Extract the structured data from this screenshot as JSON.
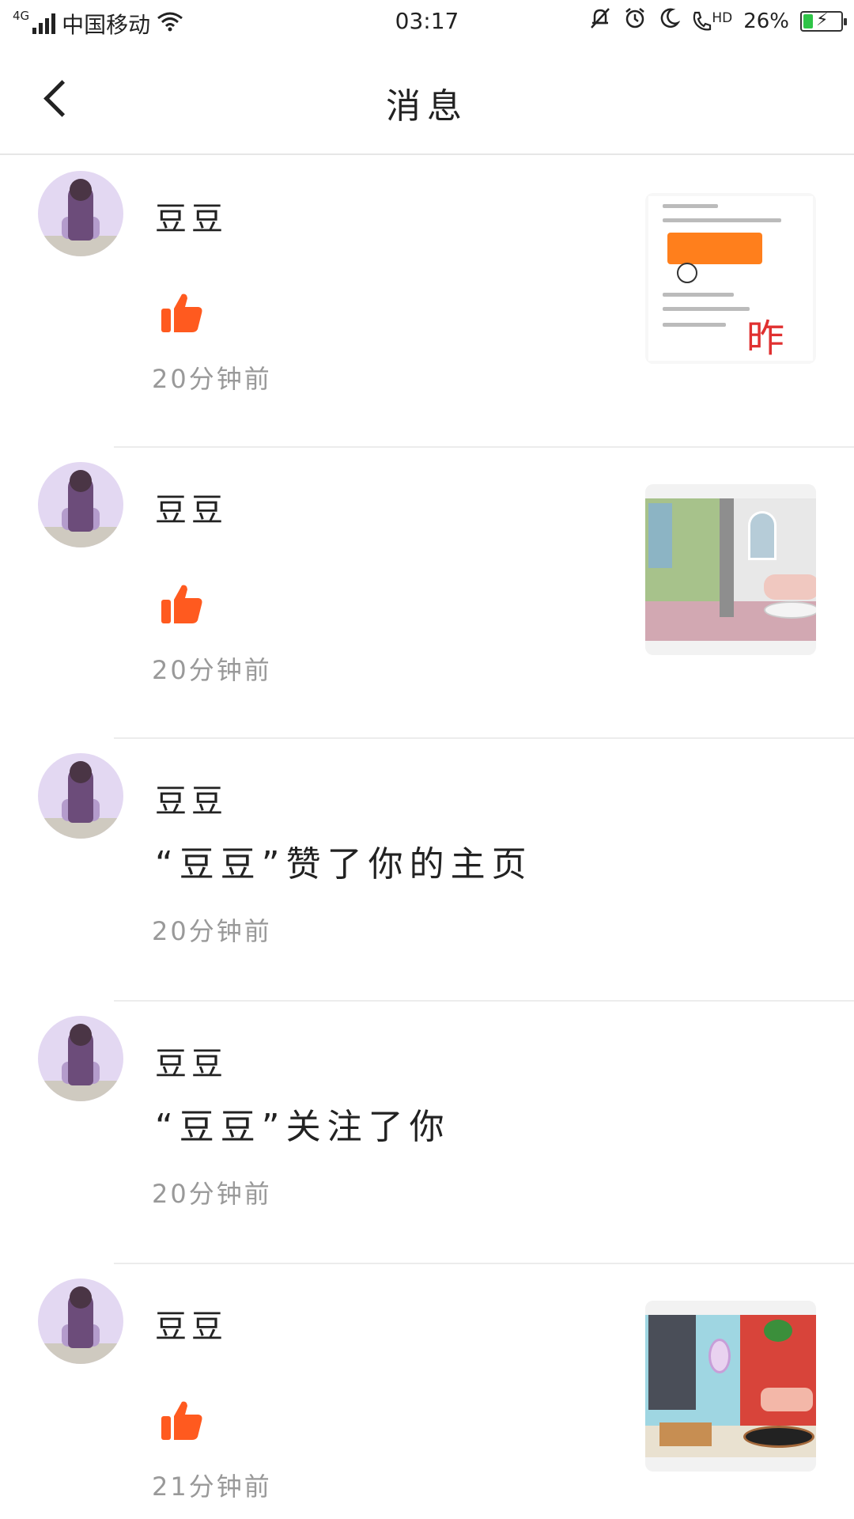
{
  "status_bar": {
    "network": "4G",
    "carrier": "中国移动",
    "time": "03:17",
    "call_label": "HD",
    "battery": "26%"
  },
  "header": {
    "title": "消息"
  },
  "messages": [
    {
      "user": "豆豆",
      "type": "like",
      "time": "20分钟前",
      "preview": "screenshot"
    },
    {
      "user": "豆豆",
      "type": "like",
      "time": "20分钟前",
      "preview": "room"
    },
    {
      "user": "豆豆",
      "type": "text",
      "text": "“豆豆”赞了你的主页",
      "time": "20分钟前"
    },
    {
      "user": "豆豆",
      "type": "text",
      "text": "“豆豆”关注了你",
      "time": "20分钟前"
    },
    {
      "user": "豆豆",
      "type": "like",
      "time": "21分钟前",
      "preview": "bathroom"
    }
  ],
  "colors": {
    "like_icon": "#ff5a1f",
    "time_text": "#999999",
    "divider": "#ececec",
    "battery_fill": "#2ec447"
  },
  "icons": {
    "back": "chevron-left-icon",
    "like": "thumbs-up-icon"
  }
}
